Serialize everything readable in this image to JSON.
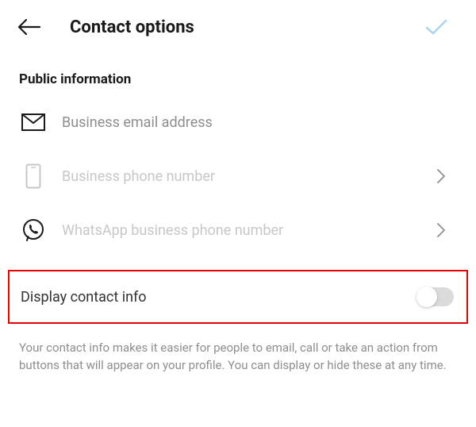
{
  "header": {
    "title": "Contact options"
  },
  "section": {
    "title": "Public information"
  },
  "options": {
    "email": {
      "label": "Business email address"
    },
    "phone": {
      "label": "Business phone number"
    },
    "whatsapp": {
      "label": "WhatsApp business phone number"
    }
  },
  "toggle": {
    "label": "Display contact info",
    "value": false
  },
  "footer": {
    "text": "Your contact info makes it easier for people to email, call or take an action from buttons that will appear on your profile. You can display or hide these at any time."
  }
}
